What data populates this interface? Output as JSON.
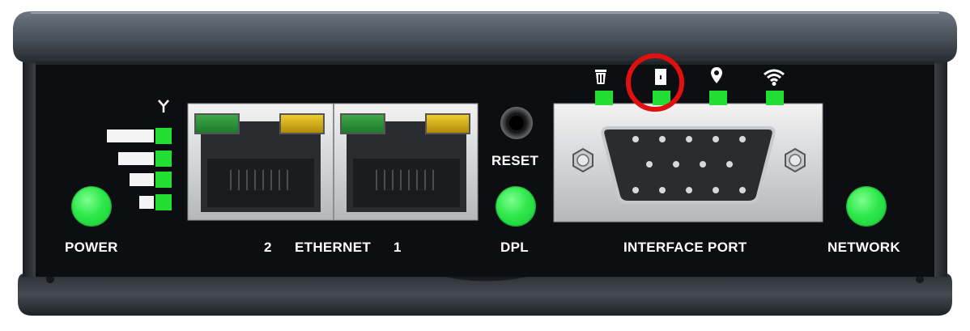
{
  "labels": {
    "power": "POWER",
    "ethernet_port_2": "2",
    "ethernet": "ETHERNET",
    "ethernet_port_1": "1",
    "reset": "RESET",
    "dpl": "DPL",
    "interface_port": "INTERFACE PORT",
    "network": "NETWORK"
  },
  "signal_strength": {
    "bars_lit": 4,
    "bars_total": 4
  },
  "interface_status_leds": [
    {
      "icon": "trash-bin-icon",
      "on": true
    },
    {
      "icon": "door-icon",
      "on": true,
      "highlighted": true
    },
    {
      "icon": "location-pin-icon",
      "on": true
    },
    {
      "icon": "wifi-icon",
      "on": true
    }
  ],
  "ethernet_ports": [
    {
      "name": "2",
      "left_led": "green",
      "right_led": "amber"
    },
    {
      "name": "1",
      "left_led": "green",
      "right_led": "amber"
    }
  ],
  "colors": {
    "led_green": "#22dd33",
    "led_amber": "#d8b010",
    "highlight_ring": "#e01010",
    "panel": "#0d0e11",
    "housing": "#4a5058"
  }
}
